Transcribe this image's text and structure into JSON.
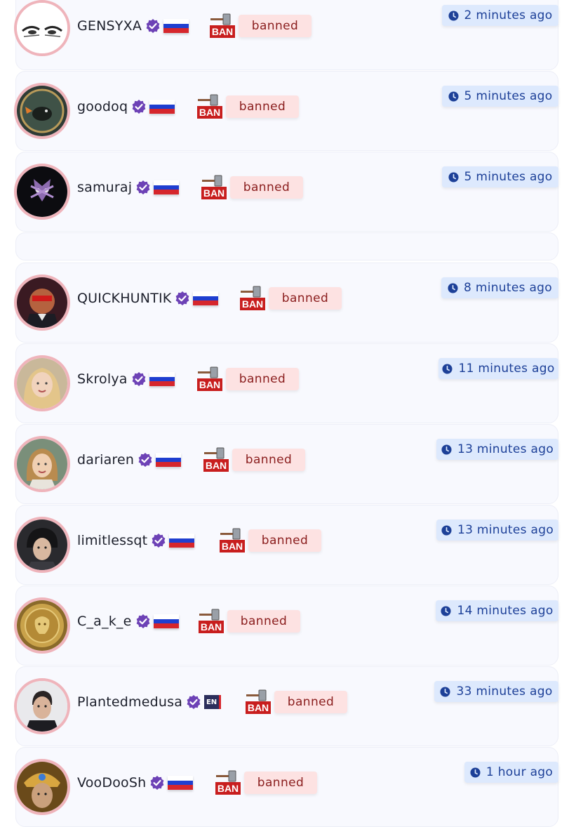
{
  "colors": {
    "card_bg": "#f8f9fe",
    "avatar_border": "#efb4bb",
    "verified": "#6d42b6",
    "banned_bg": "#fde2e2",
    "banned_text": "#8a1d1d",
    "time_bg": "#dde9fd",
    "time_text": "#1d4098"
  },
  "icons": {
    "verified": "verified-badge-icon",
    "flag": "russia-flag-icon",
    "ban": "ban-hammer-icon",
    "clock": "clock-icon"
  },
  "ban_icon_text": "BAN",
  "items": [
    {
      "username": "GENSYXA",
      "flag": "ru",
      "status": "banned",
      "time": "2 minutes ago"
    },
    {
      "username": "goodoq",
      "flag": "ru",
      "status": "banned",
      "time": "5 minutes ago"
    },
    {
      "username": "samuraj",
      "flag": "ru",
      "status": "banned",
      "time": "5 minutes ago"
    },
    {
      "username": "QUICKHUNTIK",
      "flag": "ru",
      "status": "banned",
      "time": "8 minutes ago"
    },
    {
      "username": "Skrolya",
      "flag": "ru",
      "status": "banned",
      "time": "11 minutes ago"
    },
    {
      "username": "dariaren",
      "flag": "ru",
      "status": "banned",
      "time": "13 minutes ago"
    },
    {
      "username": "limitlessqt",
      "flag": "ru",
      "status": "banned",
      "time": "13 minutes ago"
    },
    {
      "username": "C_a_k_e",
      "flag": "ru",
      "status": "banned",
      "time": "14 minutes ago"
    },
    {
      "username": "Plantedmedusa",
      "flag": "en",
      "flag_label": "EN",
      "status": "banned",
      "time": "33 minutes ago"
    },
    {
      "username": "VooDooSh",
      "flag": "ru",
      "status": "banned",
      "time": "1 hour ago"
    }
  ]
}
